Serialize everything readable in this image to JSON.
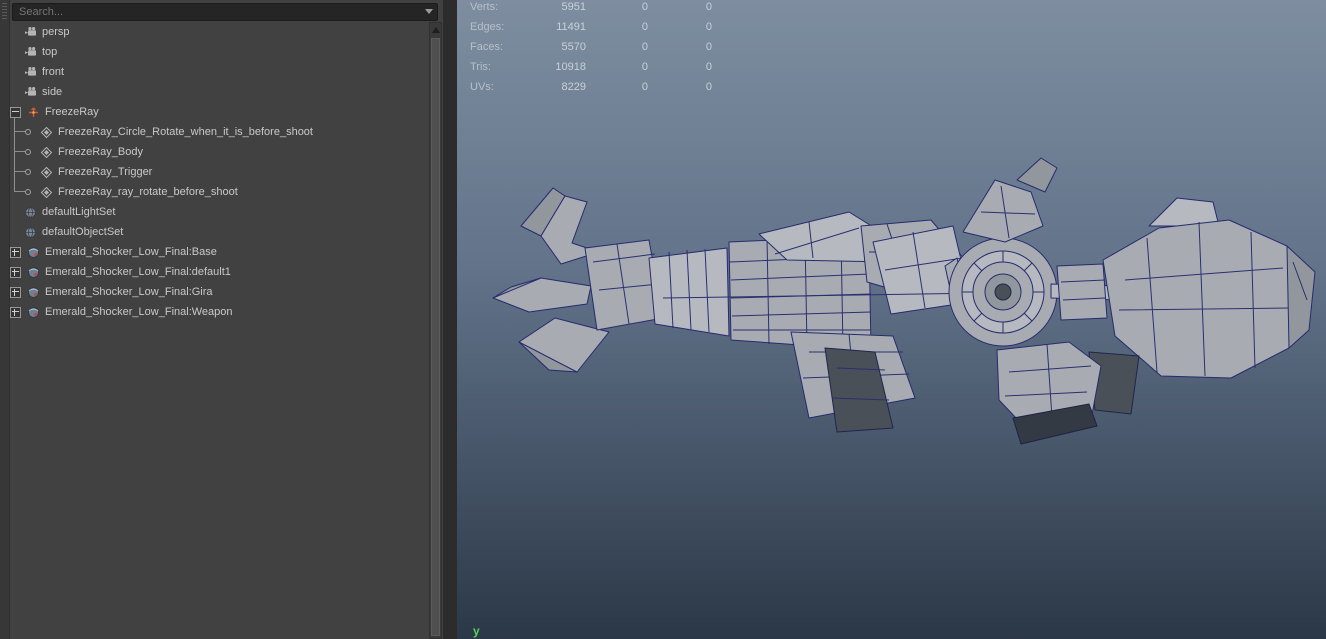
{
  "outliner": {
    "search_placeholder": "Search...",
    "items": [
      {
        "label": "persp",
        "type": "camera"
      },
      {
        "label": "top",
        "type": "camera"
      },
      {
        "label": "front",
        "type": "camera"
      },
      {
        "label": "side",
        "type": "camera"
      },
      {
        "label": "FreezeRay",
        "type": "group",
        "expanded": true
      },
      {
        "label": "FreezeRay_Circle_Rotate_when_it_is_before_shoot",
        "type": "mesh-child"
      },
      {
        "label": "FreezeRay_Body",
        "type": "mesh-child"
      },
      {
        "label": "FreezeRay_Trigger",
        "type": "mesh-child"
      },
      {
        "label": "FreezeRay_ray_rotate_before_shoot",
        "type": "mesh-child"
      },
      {
        "label": "defaultLightSet",
        "type": "set"
      },
      {
        "label": "defaultObjectSet",
        "type": "set"
      },
      {
        "label": "Emerald_Shocker_Low_Final:Base",
        "type": "namespace",
        "expanded": false
      },
      {
        "label": "Emerald_Shocker_Low_Final:default1",
        "type": "namespace",
        "expanded": false
      },
      {
        "label": "Emerald_Shocker_Low_Final:Gira",
        "type": "namespace",
        "expanded": false
      },
      {
        "label": "Emerald_Shocker_Low_Final:Weapon",
        "type": "namespace",
        "expanded": false
      }
    ]
  },
  "hud": {
    "rows": [
      {
        "label": "Verts:",
        "value": "5951",
        "col2": "0",
        "col3": "0"
      },
      {
        "label": "Edges:",
        "value": "11491",
        "col2": "0",
        "col3": "0"
      },
      {
        "label": "Faces:",
        "value": "5570",
        "col2": "0",
        "col3": "0"
      },
      {
        "label": "Tris:",
        "value": "10918",
        "col2": "0",
        "col3": "0"
      },
      {
        "label": "UVs:",
        "value": "8229",
        "col2": "0",
        "col3": "0"
      }
    ]
  },
  "viewport": {
    "axis_label": "y",
    "background_top": "#7e8ea0",
    "background_bottom": "#2b3847",
    "wireframe_color": "#262b6e",
    "axis_y_color": "#55d455"
  },
  "colors": {
    "panel_bg": "#414141",
    "search_bg": "#252525",
    "text": "#c9c9c9"
  }
}
